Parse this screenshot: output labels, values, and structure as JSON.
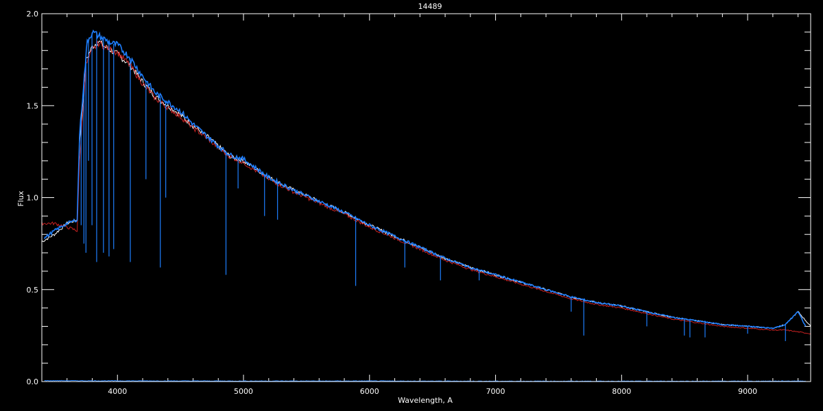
{
  "chart_data": {
    "type": "line",
    "title": "14489",
    "xlabel": "Wavelength, A",
    "ylabel": "Flux",
    "xlim": [
      3400,
      9500
    ],
    "ylim": [
      0.0,
      2.0
    ],
    "xticks": [
      4000,
      5000,
      6000,
      7000,
      8000,
      9000
    ],
    "yticks": [
      0.0,
      0.5,
      1.0,
      1.5,
      2.0
    ],
    "ytick_labels": [
      "0.0",
      "0.5",
      "1.0",
      "1.5",
      "2.0"
    ],
    "grid": false,
    "colors": {
      "background": "#000000",
      "axes": "#ffffff",
      "observed": "#ffffff",
      "model": "#cc2222",
      "fit": "#1e7fff"
    },
    "series": [
      {
        "color": "#ffffff",
        "x": [
          3400,
          3500,
          3600,
          3680,
          3700,
          3750,
          3800,
          3850,
          3900,
          4000,
          4100,
          4200,
          4300,
          4400,
          4500,
          4600,
          4700,
          4800,
          4900,
          5000,
          5200,
          5400,
          5600,
          5800,
          6000,
          6200,
          6400,
          6600,
          6800,
          7000,
          7200,
          7400,
          7600,
          7800,
          8000,
          8200,
          8400,
          8600,
          8800,
          9000,
          9200,
          9300,
          9400,
          9500
        ],
        "y": [
          0.76,
          0.8,
          0.86,
          0.88,
          1.3,
          1.75,
          1.82,
          1.85,
          1.82,
          1.78,
          1.72,
          1.63,
          1.55,
          1.5,
          1.45,
          1.39,
          1.34,
          1.28,
          1.22,
          1.2,
          1.11,
          1.04,
          0.98,
          0.92,
          0.85,
          0.79,
          0.73,
          0.67,
          0.62,
          0.58,
          0.54,
          0.5,
          0.46,
          0.43,
          0.41,
          0.38,
          0.35,
          0.33,
          0.31,
          0.3,
          0.29,
          0.31,
          0.38,
          0.3
        ]
      },
      {
        "color": "#cc2222",
        "x": [
          3400,
          3500,
          3600,
          3680,
          3700,
          3750,
          3800,
          3850,
          3900,
          4000,
          4100,
          4200,
          4300,
          4400,
          4500,
          4600,
          4700,
          4800,
          4900,
          5000,
          5200,
          5400,
          5600,
          5800,
          6000,
          6200,
          6400,
          6600,
          6800,
          7000,
          7200,
          7400,
          7600,
          7800,
          8000,
          8200,
          8400,
          8600,
          8800,
          9000,
          9200,
          9300,
          9400,
          9500
        ],
        "y": [
          0.86,
          0.86,
          0.84,
          0.82,
          1.2,
          1.72,
          1.8,
          1.84,
          1.82,
          1.79,
          1.72,
          1.62,
          1.54,
          1.49,
          1.44,
          1.38,
          1.33,
          1.27,
          1.22,
          1.19,
          1.1,
          1.03,
          0.97,
          0.91,
          0.84,
          0.78,
          0.72,
          0.66,
          0.61,
          0.57,
          0.53,
          0.49,
          0.45,
          0.42,
          0.4,
          0.37,
          0.34,
          0.32,
          0.3,
          0.29,
          0.28,
          0.28,
          0.27,
          0.26
        ]
      },
      {
        "color": "#1e7fff",
        "x": [
          3420,
          3500,
          3600,
          3680,
          3700,
          3730,
          3760,
          3800,
          3850,
          3900,
          3950,
          4000,
          4100,
          4200,
          4300,
          4400,
          4500,
          4600,
          4700,
          4800,
          4900,
          5000,
          5200,
          5400,
          5600,
          5800,
          6000,
          6200,
          6400,
          6600,
          6800,
          7000,
          7200,
          7400,
          7600,
          7800,
          8000,
          8200,
          8400,
          8600,
          8800,
          9000,
          9200,
          9300,
          9400,
          9460
        ],
        "y": [
          0.78,
          0.82,
          0.86,
          0.88,
          1.35,
          1.6,
          1.85,
          1.9,
          1.88,
          1.86,
          1.84,
          1.83,
          1.76,
          1.66,
          1.57,
          1.52,
          1.47,
          1.4,
          1.34,
          1.28,
          1.23,
          1.21,
          1.11,
          1.04,
          0.98,
          0.92,
          0.85,
          0.79,
          0.73,
          0.67,
          0.62,
          0.58,
          0.54,
          0.5,
          0.46,
          0.43,
          0.41,
          0.38,
          0.35,
          0.33,
          0.31,
          0.3,
          0.29,
          0.31,
          0.38,
          0.3
        ]
      },
      {
        "color": "#1e7fff",
        "x": [
          3420,
          4000,
          5000,
          6000,
          7000,
          8000,
          9000,
          9460
        ],
        "y": [
          0.005,
          0.004,
          0.003,
          0.003,
          0.002,
          0.002,
          0.002,
          0.003
        ]
      }
    ],
    "absorption_lines": {
      "x": [
        3712,
        3734,
        3750,
        3770,
        3798,
        3835,
        3889,
        3933,
        3970,
        4102,
        4226,
        4340,
        4383,
        4861,
        4957,
        5167,
        5270,
        5890,
        6280,
        6563,
        6870,
        7600,
        7700,
        8200,
        8498,
        8542,
        8662,
        9000,
        9300
      ],
      "y": [
        0.85,
        0.75,
        0.7,
        1.2,
        0.85,
        0.65,
        0.7,
        0.68,
        0.72,
        0.65,
        1.1,
        0.62,
        1.0,
        0.58,
        1.05,
        0.9,
        0.88,
        0.52,
        0.62,
        0.55,
        0.55,
        0.38,
        0.25,
        0.3,
        0.25,
        0.24,
        0.24,
        0.26,
        0.22
      ]
    }
  }
}
